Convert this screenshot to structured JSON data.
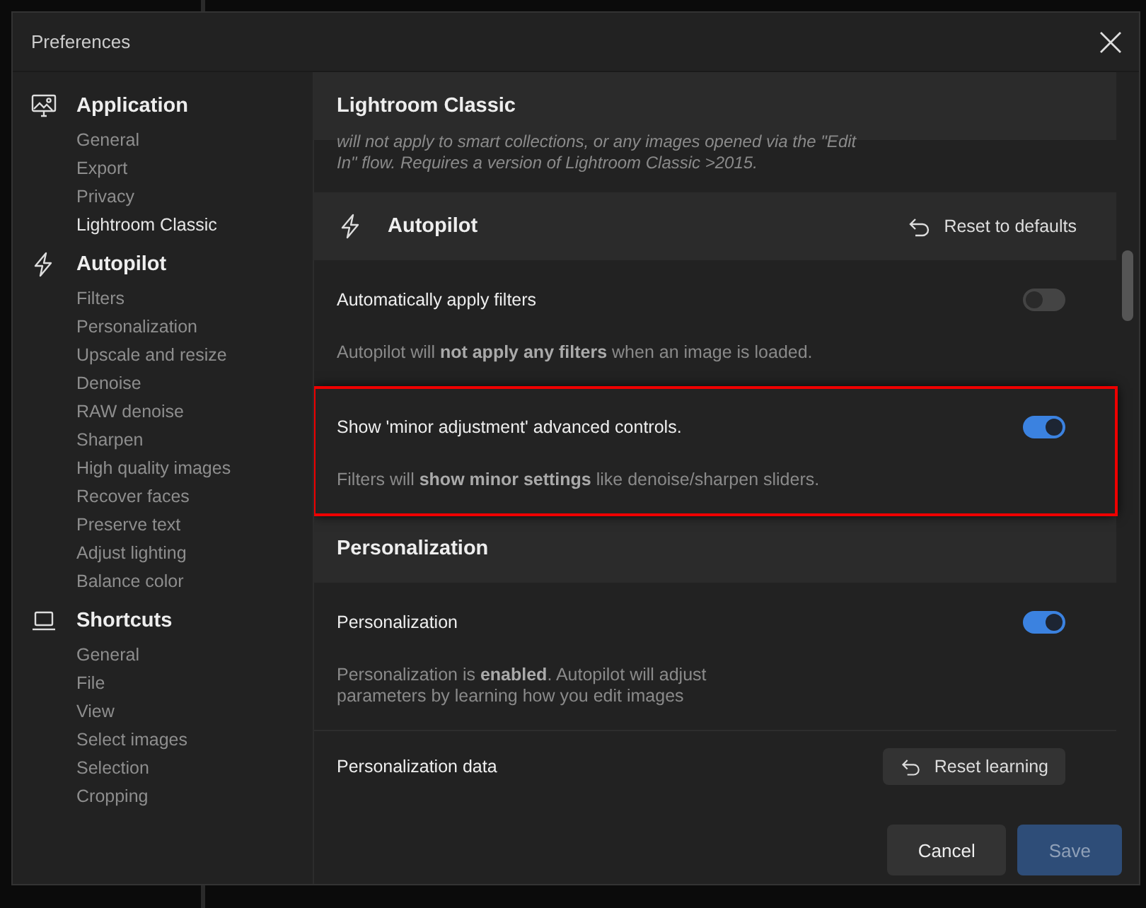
{
  "window": {
    "title": "Preferences"
  },
  "sidebar": {
    "groups": [
      {
        "title": "Application",
        "items": [
          {
            "label": "General",
            "selected": false
          },
          {
            "label": "Export",
            "selected": false
          },
          {
            "label": "Privacy",
            "selected": false
          },
          {
            "label": "Lightroom Classic",
            "selected": true
          }
        ]
      },
      {
        "title": "Autopilot",
        "items": [
          {
            "label": "Filters",
            "selected": false
          },
          {
            "label": "Personalization",
            "selected": false
          },
          {
            "label": "Upscale and resize",
            "selected": false
          },
          {
            "label": "Denoise",
            "selected": false
          },
          {
            "label": "RAW denoise",
            "selected": false
          },
          {
            "label": "Sharpen",
            "selected": false
          },
          {
            "label": "High quality images",
            "selected": false
          },
          {
            "label": "Recover faces",
            "selected": false
          },
          {
            "label": "Preserve text",
            "selected": false
          },
          {
            "label": "Adjust lighting",
            "selected": false
          },
          {
            "label": "Balance color",
            "selected": false
          }
        ]
      },
      {
        "title": "Shortcuts",
        "items": [
          {
            "label": "General",
            "selected": false
          },
          {
            "label": "File",
            "selected": false
          },
          {
            "label": "View",
            "selected": false
          },
          {
            "label": "Select images",
            "selected": false
          },
          {
            "label": "Selection",
            "selected": false
          },
          {
            "label": "Cropping",
            "selected": false
          }
        ]
      }
    ]
  },
  "content": {
    "sections": [
      {
        "title": "Lightroom Classic",
        "note": "will not apply to smart collections, or any images opened via the \"Edit In\" flow. Requires a version of Lightroom Classic >2015."
      },
      {
        "title": "Autopilot",
        "action": "Reset to defaults",
        "settings": [
          {
            "kind": "toggle",
            "label": "Automatically apply filters",
            "on": false,
            "highlighted": false,
            "description": "Autopilot will **not apply any filters** when an image is loaded."
          },
          {
            "kind": "toggle",
            "label": "Show 'minor adjustment' advanced controls.",
            "on": true,
            "highlighted": true,
            "description": "Filters will **show minor settings** like denoise/sharpen sliders."
          }
        ]
      },
      {
        "title": "Personalization",
        "settings": [
          {
            "kind": "toggle",
            "label": "Personalization",
            "on": true,
            "highlighted": false,
            "description": "Personalization is **enabled**. Autopilot will adjust parameters by learning how you edit images"
          },
          {
            "kind": "action",
            "label": "Personalization data",
            "button": "Reset learning"
          }
        ]
      }
    ]
  },
  "footer": {
    "buttons": [
      {
        "label": "Cancel",
        "kind": "secondary",
        "disabled": false
      },
      {
        "label": "Save",
        "kind": "primary",
        "disabled": true
      }
    ]
  }
}
